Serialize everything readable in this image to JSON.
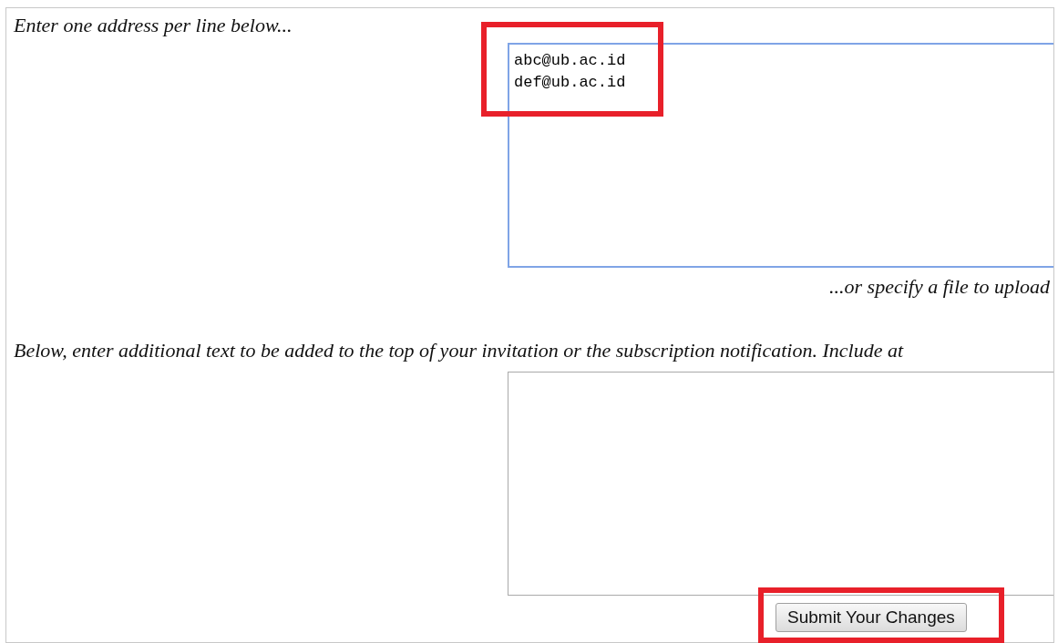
{
  "addresses": {
    "label": "Enter one address per line below...",
    "value": "abc@ub.ac.id\ndef@ub.ac.id",
    "focused": true
  },
  "upload_hint": "...or specify a file to upload",
  "invitation_text": {
    "label": "Below, enter additional text to be added to the top of your invitation or the subscription notification. Include at",
    "focused": false
  },
  "buttons": [
    "Submit Your Changes"
  ]
}
